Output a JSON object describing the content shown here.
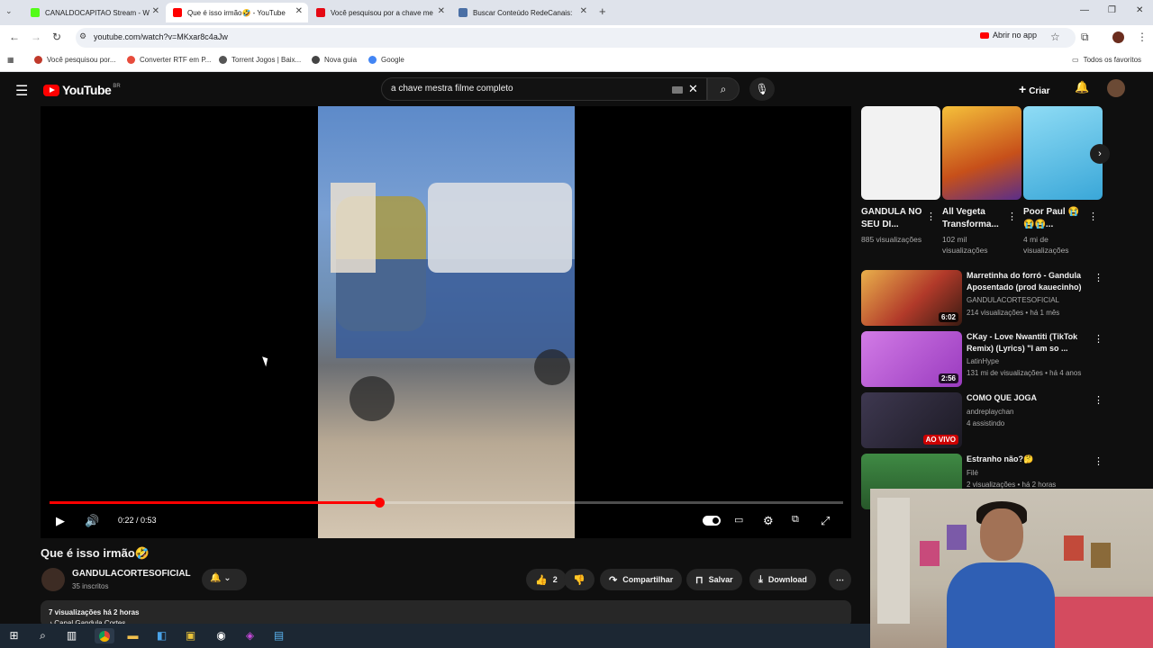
{
  "browser": {
    "tabs": [
      {
        "title": "CANALDOCAPITAO Stream - W",
        "icon": "kick-icon",
        "color": "#53fc18"
      },
      {
        "title": "Que é isso irmão🤣 - YouTube",
        "icon": "youtube-icon",
        "color": "#ff0000"
      },
      {
        "title": "Você pesquisou por a chave me",
        "icon": "netflix-icon",
        "color": "#e50914"
      },
      {
        "title": "Buscar Conteúdo RedeCanais:",
        "icon": "page-icon",
        "color": "#4a6fa5"
      }
    ],
    "new_tab": "+",
    "url": "youtube.com/watch?v=MKxar8c4aJw",
    "open_app": "Abrir no app",
    "bookmarks": [
      {
        "label": "Você pesquisou por...",
        "color": "#c0392b"
      },
      {
        "label": "Converter RTF em P...",
        "color": "#e74c3c"
      },
      {
        "label": "Torrent Jogos | Baix...",
        "color": "#555555"
      },
      {
        "label": "Nova guia",
        "color": "#444444"
      },
      {
        "label": "Google",
        "color": "#4285f4"
      }
    ],
    "all_favorites": "Todos os favoritos"
  },
  "youtube": {
    "logo": "YouTube",
    "country": "BR",
    "search_query": "a chave mestra filme completo",
    "create_label": "Criar",
    "player": {
      "time": "0:22 / 0:53",
      "progress_fraction": 0.415
    },
    "video": {
      "title": "Que é isso irmão🤣",
      "channel": "GANDULACORTESOFICIAL",
      "subscribers": "35 inscritos",
      "likes": "2",
      "share": "Compartilhar",
      "save": "Salvar",
      "download": "Download",
      "views": "7 visualizações  há 2 horas",
      "desc_line": "♪ Canal Gandula Cortes"
    },
    "shorts": [
      {
        "title": "GANDULA NO SEU DI...",
        "views": "885 visualizações",
        "color": "#f2f2f2"
      },
      {
        "title": "All Vegeta Transforma...",
        "views": "102 mil visualizações",
        "color": "#d99a2b"
      },
      {
        "title": "Poor Paul 😭😭😭...",
        "views": "4 mi de visualizações",
        "color": "#5cc4e8"
      }
    ],
    "recommendations": [
      {
        "title": "Marretinha do forró - Gandula Aposentado (prod kauecinho)",
        "channel": "GANDULACORTESOFICIAL",
        "meta": "214 visualizações • há 1 mês",
        "badge": "6:02",
        "live": false,
        "color": "#b23a2a"
      },
      {
        "title": "CKay - Love Nwantiti (TikTok Remix) (Lyrics) \"I am so ...",
        "channel": "LatinHype",
        "meta": "131 mi de visualizações • há 4 anos",
        "badge": "2:56",
        "live": false,
        "color": "#b05ac8"
      },
      {
        "title": "COMO QUE JOGA",
        "channel": "andreplaychan",
        "meta": "4 assistindo",
        "badge": "AO VIVO",
        "live": true,
        "color": "#2a2633"
      },
      {
        "title": "Estranho não?🤔",
        "channel": "Filé",
        "meta": "2 visualizações • há 2 horas",
        "badge": "",
        "live": false,
        "color": "#2f6b32"
      }
    ]
  }
}
